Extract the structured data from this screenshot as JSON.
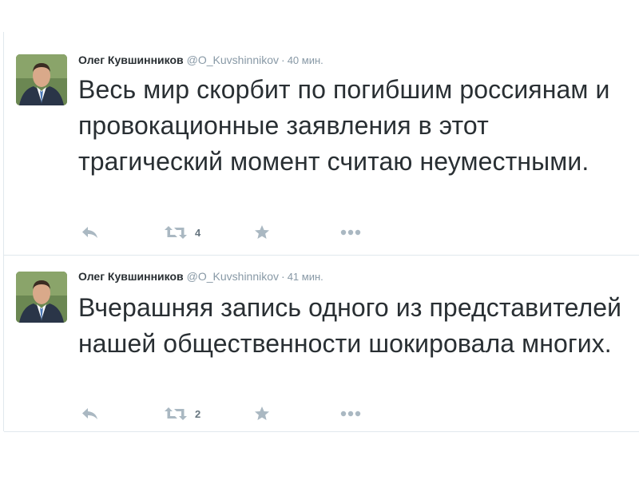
{
  "tweets": [
    {
      "fullname": "Олег Кувшинников",
      "username": "@O_Kuvshinnikov",
      "separator": "·",
      "time": "40 мин.",
      "text": "Весь мир скорбит по погибшим россиянам и провокационные заявления в этот трагический момент считаю неуместными.",
      "retweet_count": "4"
    },
    {
      "fullname": "Олег Кувшинников",
      "username": "@O_Kuvshinnikov",
      "separator": "·",
      "time": "41 мин.",
      "text": "Вчерашняя запись одного из представителей нашей общественности шокировала многих.",
      "retweet_count": "2"
    }
  ],
  "icons": {
    "reply": "reply-icon",
    "retweet": "retweet-icon",
    "favorite": "star-icon",
    "more": "more-dots-icon"
  },
  "colors": {
    "name": "#292f33",
    "meta": "#8899a6",
    "icon": "#aab8c2",
    "divider": "#e1e8ed"
  }
}
